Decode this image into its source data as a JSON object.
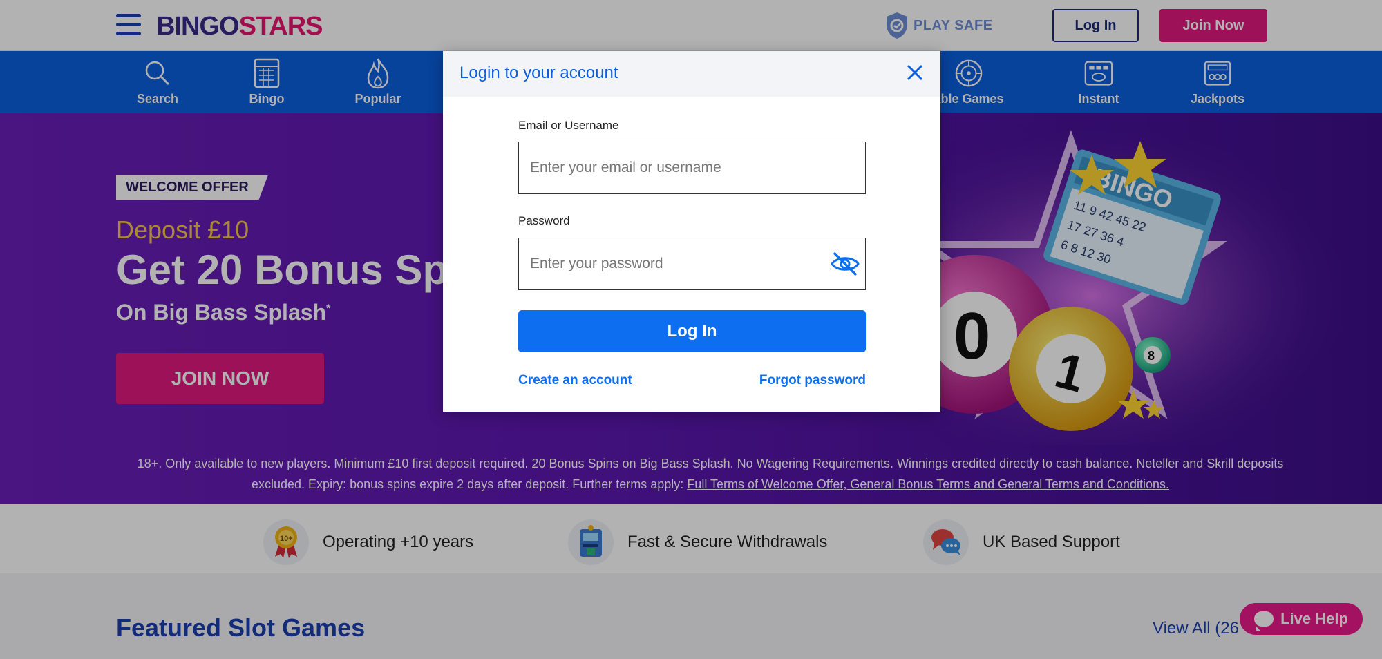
{
  "header": {
    "logo_part1": "BINGO",
    "logo_part2": "STARS",
    "play_safe": "PLAY SAFE",
    "login_label": "Log In",
    "join_label": "Join Now"
  },
  "nav": {
    "items": [
      {
        "label": "Search",
        "icon": "search-icon"
      },
      {
        "label": "Bingo",
        "icon": "bingo-card-icon"
      },
      {
        "label": "Popular",
        "icon": "flame-icon"
      },
      {
        "label": "able Games",
        "icon": "roulette-icon"
      },
      {
        "label": "Instant",
        "icon": "scratch-card-icon"
      },
      {
        "label": "Jackpots",
        "icon": "jackpot-icon"
      }
    ]
  },
  "hero": {
    "badge": "WELCOME OFFER",
    "deposit": "Deposit £10",
    "headline": "Get 20 Bonus Sp",
    "subline": "On Big Bass Splash",
    "subline_mark": "*",
    "join_label": "JOIN NOW",
    "terms_text": "18+. Only available to new players. Minimum £10 first deposit required. 20 Bonus Spins on Big Bass Splash. No Wagering Requirements. Winnings credited directly to cash balance. Neteller and Skrill deposits excluded. Expiry: bonus spins expire 2 days after deposit. Further terms apply: ",
    "terms_link": "Full Terms of Welcome Offer, General Bonus Terms and General Terms and Conditions."
  },
  "features": [
    {
      "label": "Operating +10 years",
      "icon": "award-ribbon-icon"
    },
    {
      "label": "Fast & Secure Withdrawals",
      "icon": "secure-atm-icon"
    },
    {
      "label": "UK Based Support",
      "icon": "chat-bubbles-icon"
    }
  ],
  "featured": {
    "title": "Featured Slot Games",
    "view_all": "View All (26"
  },
  "live_help": "Live Help",
  "modal": {
    "title": "Login to your account",
    "email_label": "Email or Username",
    "email_placeholder": "Enter your email or username",
    "email_value": "",
    "password_label": "Password",
    "password_placeholder": "Enter your password",
    "password_value": "",
    "login_label": "Log In",
    "create_account": "Create an account",
    "forgot_password": "Forgot password"
  },
  "colors": {
    "brand_blue": "#0b5fdf",
    "brand_pink": "#e1197e",
    "hero_purple": "#5c17b0",
    "button_blue": "#0d6ff0"
  }
}
